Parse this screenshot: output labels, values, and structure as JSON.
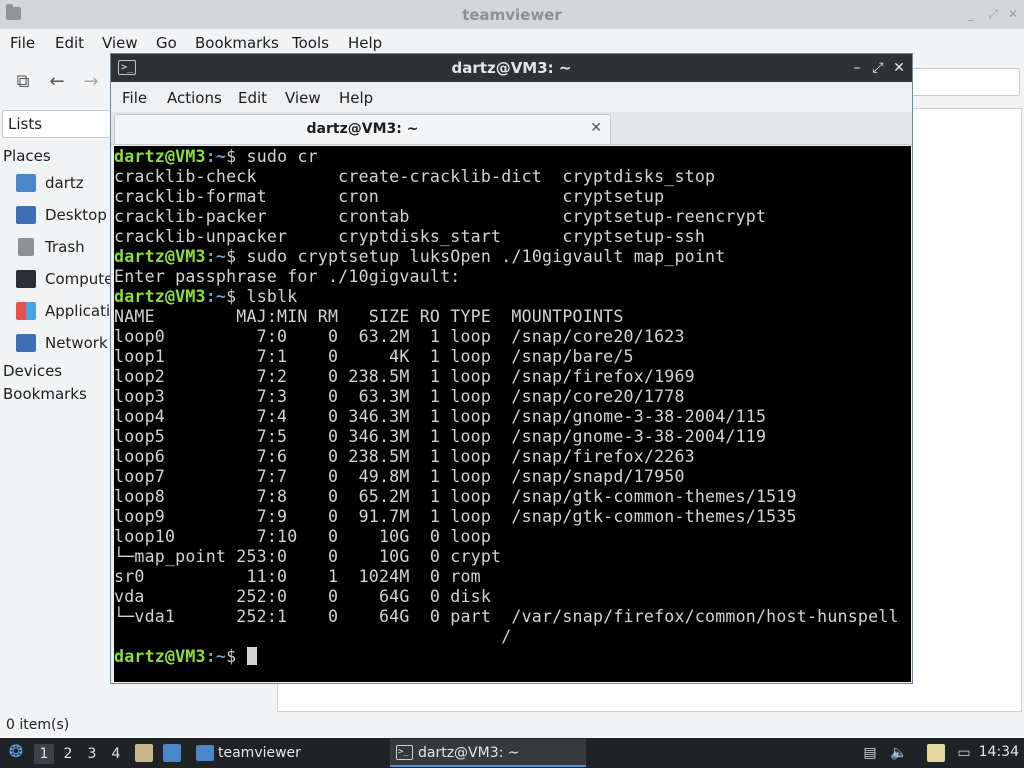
{
  "file_manager": {
    "title": "teamviewer",
    "menu": [
      "File",
      "Edit",
      "View",
      "Go",
      "Bookmarks",
      "Tools",
      "Help"
    ],
    "sidebar_mode": "Lists",
    "places_header": "Places",
    "places": [
      {
        "label": "dartz",
        "icon": "home-folder-icon"
      },
      {
        "label": "Desktop",
        "icon": "desktop-icon"
      },
      {
        "label": "Trash",
        "icon": "trash-icon"
      },
      {
        "label": "Computer",
        "icon": "computer-icon"
      },
      {
        "label": "Applications",
        "icon": "applications-icon"
      },
      {
        "label": "Network",
        "icon": "network-icon"
      }
    ],
    "devices_header": "Devices",
    "bookmarks_header": "Bookmarks",
    "status": "0 item(s)"
  },
  "terminal": {
    "title": "dartz@VM3: ~",
    "menu": [
      "File",
      "Actions",
      "Edit",
      "View",
      "Help"
    ],
    "tab_label": "dartz@VM3: ~",
    "prompt_user": "dartz@VM3",
    "prompt_path": ":~",
    "prompt_sign": "$ ",
    "lines": [
      {
        "type": "cmd",
        "text": "sudo cr"
      },
      {
        "type": "out",
        "text": "cracklib-check        create-cracklib-dict  cryptdisks_stop"
      },
      {
        "type": "out",
        "text": "cracklib-format       cron                  cryptsetup"
      },
      {
        "type": "out",
        "text": "cracklib-packer       crontab               cryptsetup-reencrypt"
      },
      {
        "type": "out",
        "text": "cracklib-unpacker     cryptdisks_start      cryptsetup-ssh"
      },
      {
        "type": "cmd",
        "text": "sudo cryptsetup luksOpen ./10gigvault map_point"
      },
      {
        "type": "out",
        "text": "Enter passphrase for ./10gigvault:"
      },
      {
        "type": "cmd",
        "text": "lsblk"
      },
      {
        "type": "out",
        "text": "NAME        MAJ:MIN RM   SIZE RO TYPE  MOUNTPOINTS"
      },
      {
        "type": "out",
        "text": "loop0         7:0    0  63.2M  1 loop  /snap/core20/1623"
      },
      {
        "type": "out",
        "text": "loop1         7:1    0     4K  1 loop  /snap/bare/5"
      },
      {
        "type": "out",
        "text": "loop2         7:2    0 238.5M  1 loop  /snap/firefox/1969"
      },
      {
        "type": "out",
        "text": "loop3         7:3    0  63.3M  1 loop  /snap/core20/1778"
      },
      {
        "type": "out",
        "text": "loop4         7:4    0 346.3M  1 loop  /snap/gnome-3-38-2004/115"
      },
      {
        "type": "out",
        "text": "loop5         7:5    0 346.3M  1 loop  /snap/gnome-3-38-2004/119"
      },
      {
        "type": "out",
        "text": "loop6         7:6    0 238.5M  1 loop  /snap/firefox/2263"
      },
      {
        "type": "out",
        "text": "loop7         7:7    0  49.8M  1 loop  /snap/snapd/17950"
      },
      {
        "type": "out",
        "text": "loop8         7:8    0  65.2M  1 loop  /snap/gtk-common-themes/1519"
      },
      {
        "type": "out",
        "text": "loop9         7:9    0  91.7M  1 loop  /snap/gtk-common-themes/1535"
      },
      {
        "type": "out",
        "text": "loop10        7:10   0    10G  0 loop"
      },
      {
        "type": "out",
        "text": "└─map_point 253:0    0    10G  0 crypt"
      },
      {
        "type": "out",
        "text": "sr0          11:0    1  1024M  0 rom"
      },
      {
        "type": "out",
        "text": "vda         252:0    0    64G  0 disk"
      },
      {
        "type": "out",
        "text": "└─vda1      252:1    0    64G  0 part  /var/snap/firefox/common/host-hunspell"
      },
      {
        "type": "out",
        "text": "                                      /"
      },
      {
        "type": "prompt",
        "text": ""
      }
    ]
  },
  "panel": {
    "workspaces": [
      "1",
      "2",
      "3",
      "4"
    ],
    "active_workspace": "1",
    "tasks": [
      {
        "label": "teamviewer",
        "icon": "folder-icon"
      },
      {
        "label": "dartz@VM3: ~",
        "icon": "terminal-icon"
      }
    ],
    "clock": "14:34"
  }
}
